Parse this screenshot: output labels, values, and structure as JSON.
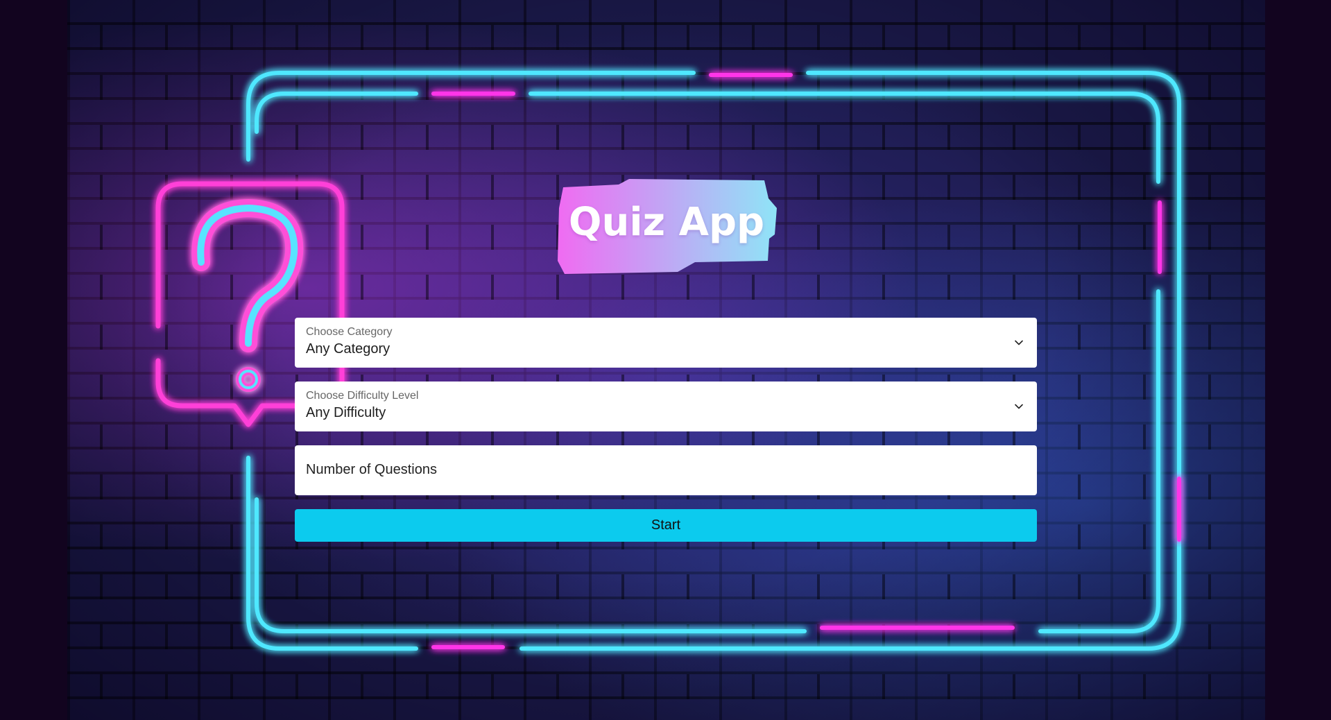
{
  "app": {
    "title": "Quiz App"
  },
  "form": {
    "category": {
      "label": "Choose Category",
      "value": "Any Category"
    },
    "difficulty": {
      "label": "Choose Difficulty Level",
      "value": "Any Difficulty"
    },
    "questions": {
      "placeholder": "Number of Questions"
    },
    "start_label": "Start"
  },
  "icons": {
    "dropdown": "chevron-down-icon",
    "decoration": "question-mark-icon"
  },
  "colors": {
    "neon_cyan": "#1ee0ff",
    "neon_magenta": "#ff36e8",
    "start_button": "#0ccbee",
    "title_gradient_start": "#f06bf2",
    "title_gradient_end": "#8fe4f7"
  }
}
